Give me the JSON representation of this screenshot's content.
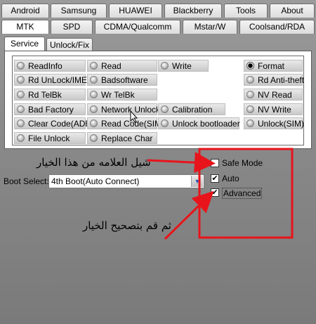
{
  "tabs_row1": [
    "Android",
    "Samsung",
    "HUAWEI",
    "Blackberry",
    "Tools",
    "About"
  ],
  "tabs_row2": [
    "MTK",
    "SPD",
    "CDMA/Qualcomm",
    "Mstar/W",
    "Coolsand/RDA"
  ],
  "subtabs": [
    "Service",
    "Unlock/Fix"
  ],
  "buttons": {
    "col1": [
      "ReadInfo",
      "Rd UnLock/IMEI",
      "Rd TelBk",
      "Bad Factory",
      "Clear Code(ADB)",
      "File Unlock"
    ],
    "col2": [
      "Read",
      "Badsoftware",
      "Wr TelBk",
      "Network Unlock",
      "Read Code(SIM)",
      "Replace Char"
    ],
    "col3": [
      "Write",
      "Calibration",
      "Unlock bootloader"
    ],
    "col4": [
      "Format",
      "Rd Anti-theft",
      "NV Read",
      "NV Write",
      "Unlock(SIM)"
    ]
  },
  "boot_select": {
    "label": "Boot Select:",
    "value": "4th Boot(Auto Connect)"
  },
  "options": [
    {
      "label": "Safe Mode",
      "checked": false
    },
    {
      "label": "Auto",
      "checked": true
    },
    {
      "label": "Advanced",
      "checked": true
    }
  ],
  "annotations": {
    "top": "شيل العلامه من هذا الخيار",
    "bottom": "ثم قم بتصحيح الخيار",
    "color": "#e8141b"
  },
  "colors": {
    "background": "#8a8a8a",
    "accent": "#e8141b"
  }
}
